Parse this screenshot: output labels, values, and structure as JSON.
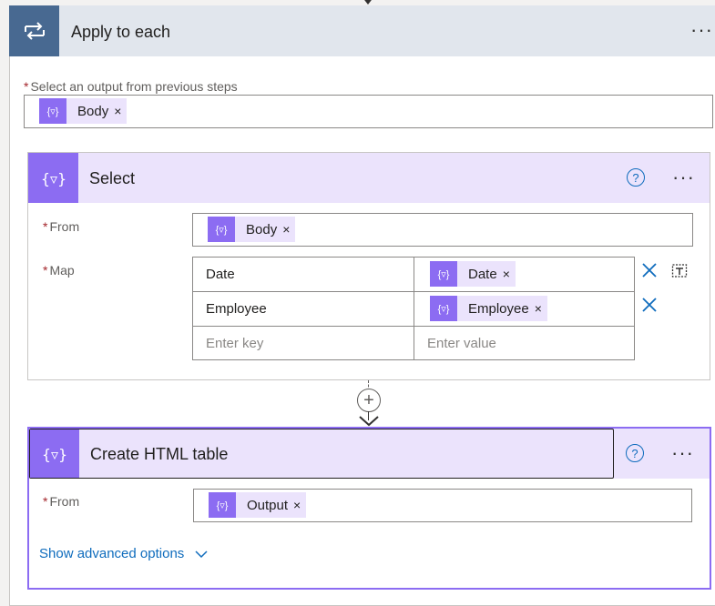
{
  "loop": {
    "title": "Apply to each",
    "menu": "···",
    "select_output_label": "Select an output from previous steps",
    "output_token": "Body"
  },
  "select_action": {
    "title": "Select",
    "help": "?",
    "menu": "···",
    "from_label": "From",
    "from_token": "Body",
    "map_label": "Map",
    "rows": [
      {
        "key": "Date",
        "value_token": "Date"
      },
      {
        "key": "Employee",
        "value_token": "Employee"
      }
    ],
    "key_placeholder": "Enter key",
    "value_placeholder": "Enter value"
  },
  "add_step": "+",
  "html_table_action": {
    "title": "Create HTML table",
    "help": "?",
    "menu": "···",
    "from_label": "From",
    "from_token": "Output",
    "advanced_link": "Show advanced options"
  },
  "common": {
    "required_mark": "*",
    "remove_glyph": "×",
    "token_icon_text": "{▿}"
  },
  "colors": {
    "loop_icon_bg": "#486991",
    "loop_header_bg": "#e1e6ed",
    "action_icon_bg": "#8c6cf2",
    "action_header_bg": "#ebe3fc",
    "link": "#0f6cbd",
    "required": "#a4262c"
  }
}
